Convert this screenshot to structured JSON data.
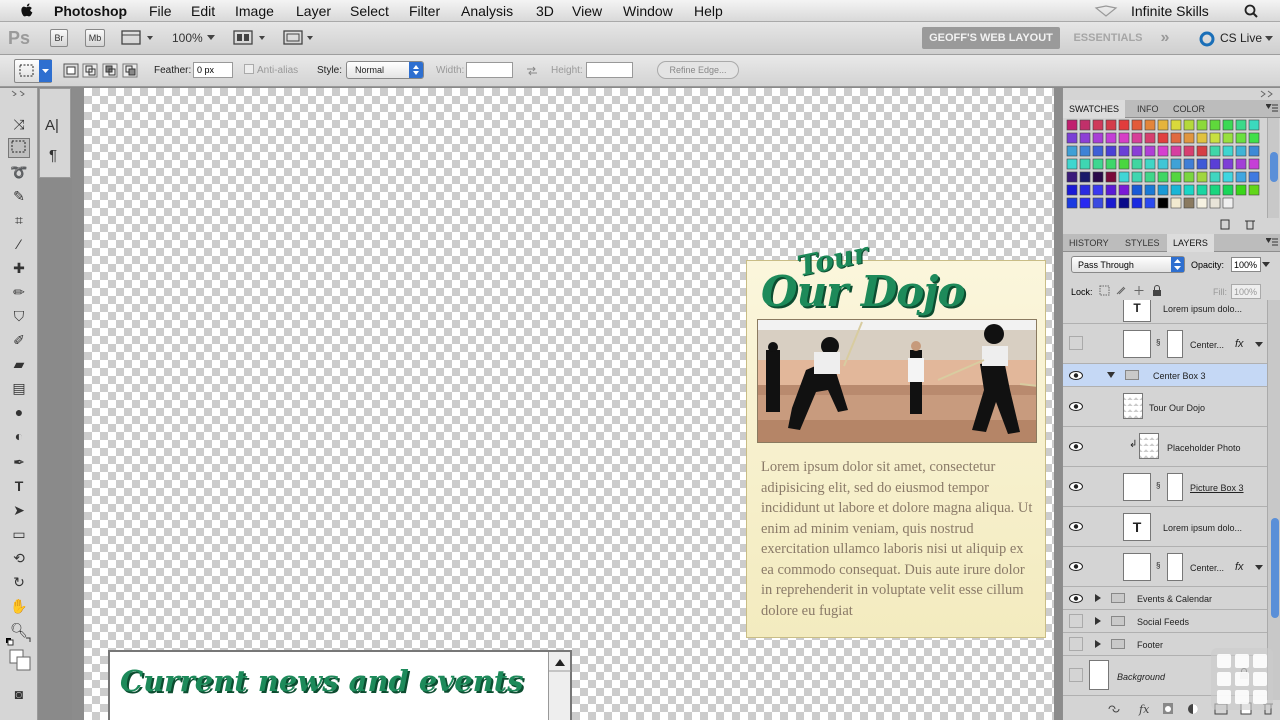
{
  "menubar": {
    "app": "Photoshop",
    "items": [
      "File",
      "Edit",
      "Image",
      "Layer",
      "Select",
      "Filter",
      "Analysis",
      "3D",
      "View",
      "Window",
      "Help"
    ],
    "right_label": "Infinite Skills"
  },
  "appbar": {
    "logo": "Ps",
    "br": "Br",
    "mb": "Mb",
    "zoom": "100%",
    "workspace_active": "GEOFF'S WEB LAYOUT",
    "workspace_other": "ESSENTIALS",
    "more": "»",
    "cs_live": "CS Live"
  },
  "options": {
    "feather_label": "Feather:",
    "feather_value": "0 px",
    "antialias": "Anti-alias",
    "style_label": "Style:",
    "style_value": "Normal",
    "width_label": "Width:",
    "height_label": "Height:",
    "refine": "Refine Edge..."
  },
  "document": {
    "dojo_title_top": "Tour",
    "dojo_title_main": "Our Dojo",
    "dojo_body": "Lorem ipsum dolor sit amet, consectetur adipisicing elit, sed do eiusmod tempor incididunt ut labore et dolore magna aliqua. Ut enim ad minim veniam, quis nostrud exercitation ullamco laboris nisi ut aliquip ex ea commodo consequat. Duis aute irure dolor in reprehenderit in voluptate velit esse cillum dolore eu fugiat",
    "news_title": "Current news and events"
  },
  "swatch_panel": {
    "tabs": [
      "SWATCHES",
      "INFO",
      "COLOR"
    ]
  },
  "layers_panel": {
    "tabs": [
      "HISTORY",
      "STYLES",
      "LAYERS"
    ],
    "blend_mode": "Pass Through",
    "opacity_label": "Opacity:",
    "opacity_value": "100%",
    "lock_label": "Lock:",
    "fill_label": "Fill:",
    "fill_value": "100%",
    "layers": [
      {
        "name": "Lorem ipsum dolo..."
      },
      {
        "name": "Center..."
      },
      {
        "name": "Center Box 3"
      },
      {
        "name": "Tour Our Dojo"
      },
      {
        "name": "Placeholder Photo"
      },
      {
        "name": "Picture Box 3"
      },
      {
        "name": "Lorem ipsum dolo..."
      },
      {
        "name": "Center..."
      },
      {
        "name": "Events & Calendar"
      },
      {
        "name": "Social Feeds"
      },
      {
        "name": "Footer"
      },
      {
        "name": "Background"
      }
    ],
    "fx": "fx"
  }
}
